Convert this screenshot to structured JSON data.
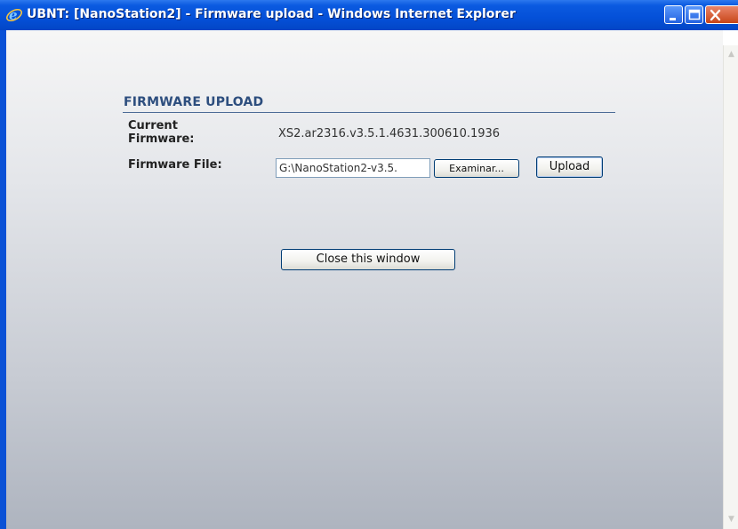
{
  "window": {
    "title": "UBNT: [NanoStation2] - Firmware upload - Windows Internet Explorer",
    "controls": {
      "minimize_icon": "minimize-icon",
      "maximize_icon": "maximize-icon",
      "close_icon": "close-icon"
    },
    "app_icon": "internet-explorer-icon"
  },
  "form": {
    "section_title": "FIRMWARE UPLOAD",
    "current_firmware_label": "Current Firmware:",
    "current_firmware_value": "XS2.ar2316.v3.5.1.4631.300610.1936",
    "firmware_file_label": "Firmware File:",
    "firmware_file_value": "G:\\NanoStation2-v3.5.",
    "browse_label": "Examinar...",
    "upload_label": "Upload",
    "close_label": "Close this window"
  },
  "colors": {
    "titlebar": "#0450d8",
    "section_title": "#2d4e7e",
    "close_button": "#c84518"
  }
}
